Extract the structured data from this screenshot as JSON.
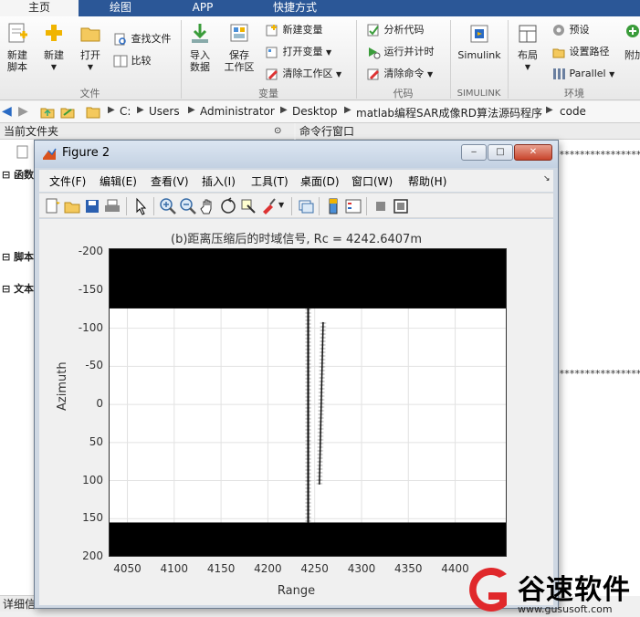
{
  "ribbon": {
    "tabs": [
      "主页",
      "绘图",
      "APP",
      "快捷方式"
    ],
    "sections": {
      "file": "文件",
      "variable": "变量",
      "code": "代码",
      "simulink": "SIMULINK",
      "environment": "环境"
    },
    "buttons": {
      "new_script": "新建\n脚本",
      "new": "新建",
      "open": "打开",
      "find_files": "查找文件",
      "compare": "比较",
      "import_data": "导入\n数据",
      "save_workspace": "保存\n工作区",
      "new_variable": "新建变量",
      "open_variable": "打开变量",
      "clear_workspace": "清除工作区",
      "analyze_code": "分析代码",
      "run_and_time": "运行并计时",
      "clear_commands": "清除命令",
      "simulink": "Simulink",
      "layout": "布局",
      "preferences": "预设",
      "set_path": "设置路径",
      "parallel": "Parallel",
      "addons": "附加"
    }
  },
  "address": {
    "path": [
      "C:",
      "Users",
      "Administrator",
      "Desktop",
      "matlab编程SAR成像RD算法源码程序",
      "code"
    ]
  },
  "panels": {
    "current_folder": "当前文件夹",
    "command_window": "命令行窗口",
    "details": "详细信",
    "left_items": [
      "函数",
      "脚本",
      "文本"
    ]
  },
  "figure": {
    "title": "Figure 2",
    "menus": [
      "文件(F)",
      "编辑(E)",
      "查看(V)",
      "插入(I)",
      "工具(T)",
      "桌面(D)",
      "窗口(W)",
      "帮助(H)"
    ],
    "window_buttons": {
      "minimize": "‒",
      "maximize": "□",
      "close": "✕"
    }
  },
  "chart_data": {
    "type": "heatmap",
    "title": "(b)距离压缩后的时域信号, Rc = 4242.6407m",
    "xlabel": "Range",
    "ylabel": "Azimuth",
    "xlim": [
      4030,
      4455
    ],
    "ylim": [
      -205,
      200
    ],
    "y_reversed": true,
    "grid": true,
    "x_ticks": [
      4050,
      4100,
      4150,
      4200,
      4250,
      4300,
      4350,
      4400
    ],
    "y_ticks": [
      -200,
      -150,
      -100,
      -50,
      0,
      50,
      100,
      150,
      200
    ],
    "black_bands_y": [
      [
        -205,
        -126
      ],
      [
        155,
        200
      ]
    ],
    "signal_traces": [
      {
        "x_start": 4243,
        "x_end": 4243,
        "y_start": -126,
        "y_end": 155
      },
      {
        "x_start": 4259,
        "x_end": 4255,
        "y_start": -108,
        "y_end": 105
      }
    ]
  },
  "watermark": {
    "text": "谷速软件",
    "url": "www.gususoft.com"
  },
  "colors": {
    "ribbon_blue": "#2b5797",
    "watermark_red": "#e0282b"
  }
}
